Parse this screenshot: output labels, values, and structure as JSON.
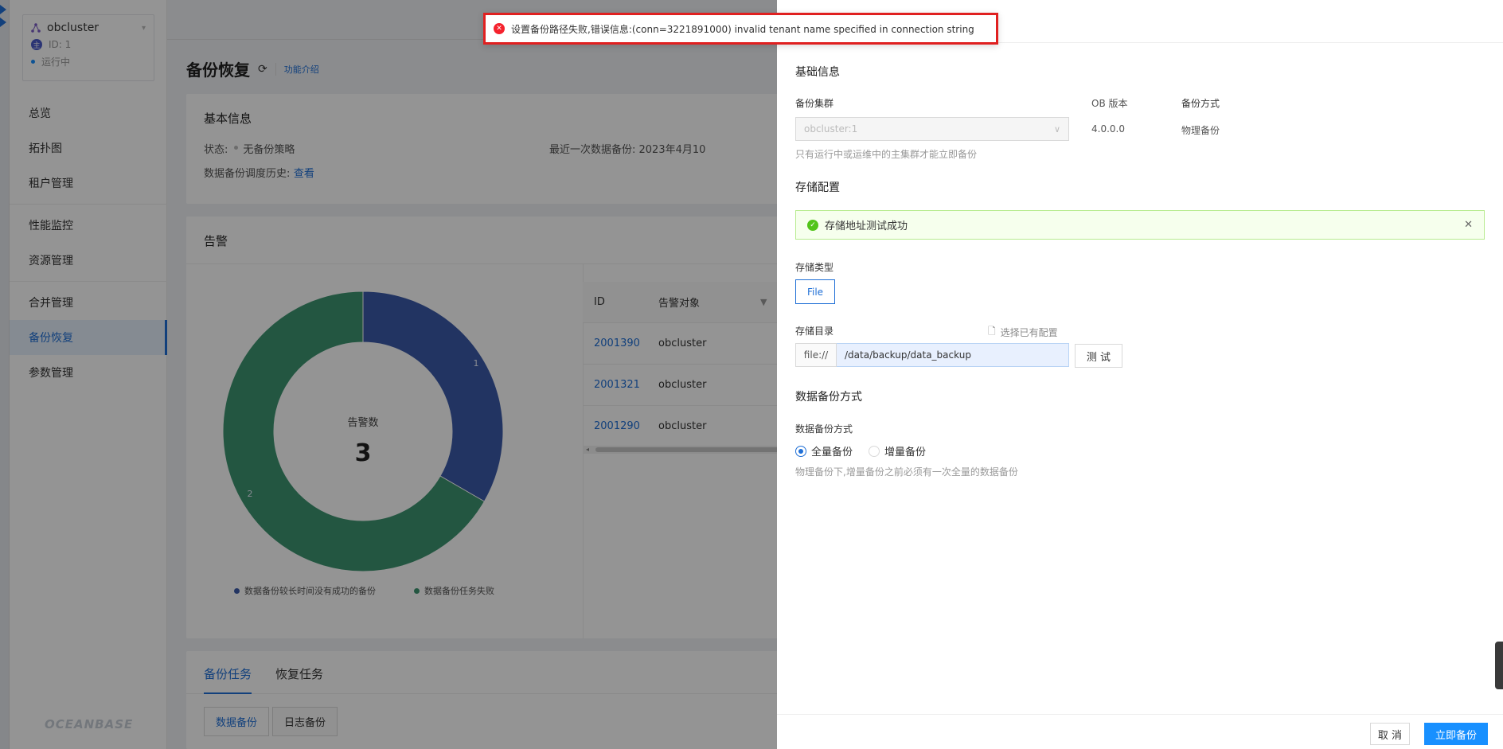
{
  "cluster": {
    "name": "obcluster",
    "id_label": "ID: 1",
    "status": "运行中",
    "master_badge": "主"
  },
  "nav": {
    "items": [
      "总览",
      "拓扑图",
      "租户管理",
      "性能监控",
      "资源管理",
      "合并管理",
      "备份恢复",
      "参数管理"
    ],
    "active": "备份恢复"
  },
  "logo": "OCEANBASE",
  "page": {
    "title": "备份恢复",
    "intro_link": "功能介绍"
  },
  "basic": {
    "title": "基本信息",
    "status_label": "状态:",
    "status_value": "无备份策略",
    "last_backup_label": "最近一次数据备份: 2023年4月10",
    "history_label": "数据备份调度历史:",
    "history_link": "查看"
  },
  "alarm": {
    "title": "告警",
    "center_label": "告警数",
    "total": "3",
    "table_headers": [
      "ID",
      "告警对象"
    ],
    "rows": [
      {
        "id": "2001390",
        "target": "obcluster"
      },
      {
        "id": "2001321",
        "target": "obcluster"
      },
      {
        "id": "2001290",
        "target": "obcluster"
      }
    ]
  },
  "chart_data": {
    "type": "pie",
    "categories": [
      "数据备份较长时间没有成功的备份",
      "数据备份任务失败"
    ],
    "values": [
      1,
      2
    ],
    "colors": [
      "#3b5ba9",
      "#3d9470"
    ],
    "center_label": "告警数",
    "center_value": "3",
    "legend": "bottom"
  },
  "tasks": {
    "tabs": [
      "备份任务",
      "恢复任务"
    ],
    "subtabs": [
      "数据备份",
      "日志备份"
    ]
  },
  "drawer": {
    "section_basic": "基础信息",
    "cluster_label": "备份集群",
    "cluster_placeholder": "obcluster:1",
    "ob_version_label": "OB 版本",
    "ob_version": "4.0.0.0",
    "backup_mode_label": "备份方式",
    "backup_mode": "物理备份",
    "cluster_help": "只有运行中或运维中的主集群才能立即备份",
    "section_storage": "存储配置",
    "alert_success": "存储地址测试成功",
    "storage_type_label": "存储类型",
    "storage_type": "File",
    "storage_dir_label": "存储目录",
    "pick_existing": "选择已有配置",
    "dir_prefix": "file://",
    "dir_value": "/data/backup/data_backup",
    "test_button": "测 试",
    "section_data_backup": "数据备份方式",
    "data_backup_label": "数据备份方式",
    "opt_full": "全量备份",
    "opt_incr": "增量备份",
    "data_backup_help": "物理备份下,增量备份之前必须有一次全量的数据备份",
    "cancel": "取 消",
    "submit": "立即备份"
  },
  "toast": {
    "message": "设置备份路径失败,错误信息:(conn=3221891000) invalid tenant name specified in connection string"
  }
}
